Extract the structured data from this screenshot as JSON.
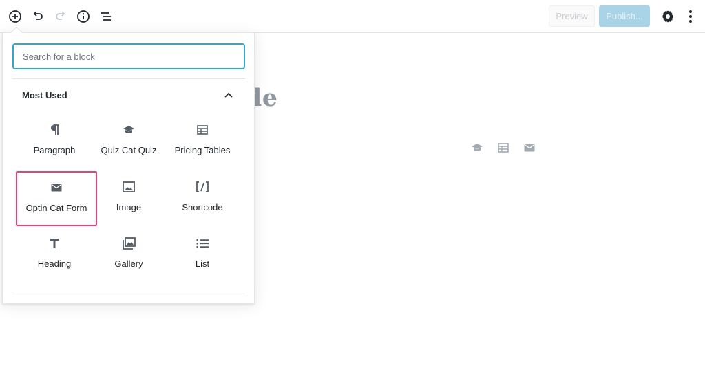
{
  "toolbar": {
    "add_block_icon": "plus-circle-icon",
    "undo_icon": "undo-icon",
    "redo_icon": "redo-icon",
    "info_icon": "info-icon",
    "outline_icon": "list-outline-icon",
    "preview_label": "Preview",
    "publish_label": "Publish...",
    "settings_icon": "gear-icon",
    "more_icon": "kebab-menu-icon",
    "colors": {
      "accent": "#2fa8d1",
      "publish_bg": "#a9d3e6",
      "highlight": "#e8407f"
    }
  },
  "editor": {
    "title_fragment": "le"
  },
  "inserter": {
    "search_placeholder": "Search for a block",
    "section_title": "Most Used",
    "section_toggle_icon": "chevron-up-icon",
    "blocks": [
      {
        "label": "Paragraph",
        "icon": "paragraph-icon"
      },
      {
        "label": "Quiz Cat Quiz",
        "icon": "graduation-cap-icon"
      },
      {
        "label": "Pricing Tables",
        "icon": "table-icon"
      },
      {
        "label": "Optin Cat Form",
        "icon": "envelope-icon",
        "selected": true
      },
      {
        "label": "Image",
        "icon": "image-icon"
      },
      {
        "label": "Shortcode",
        "icon": "shortcode-icon"
      },
      {
        "label": "Heading",
        "icon": "heading-icon"
      },
      {
        "label": "Gallery",
        "icon": "gallery-icon"
      },
      {
        "label": "List",
        "icon": "list-icon"
      }
    ]
  }
}
